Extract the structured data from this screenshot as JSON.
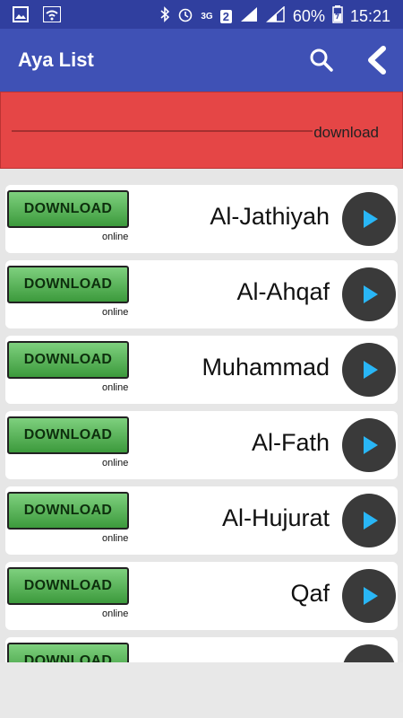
{
  "status_bar": {
    "network_type": "3G",
    "sim_slot": "2",
    "battery": "60%",
    "time": "15:21"
  },
  "app_bar": {
    "title": "Aya List"
  },
  "download_banner": {
    "label": "download",
    "color": "#e54646"
  },
  "list": {
    "items": [
      {
        "name": "Al-Jathiyah",
        "download_label": "DOWNLOAD",
        "source": "online"
      },
      {
        "name": "Al-Ahqaf",
        "download_label": "DOWNLOAD",
        "source": "online"
      },
      {
        "name": "Muhammad",
        "download_label": "DOWNLOAD",
        "source": "online"
      },
      {
        "name": "Al-Fath",
        "download_label": "DOWNLOAD",
        "source": "online"
      },
      {
        "name": "Al-Hujurat",
        "download_label": "DOWNLOAD",
        "source": "online"
      },
      {
        "name": "Qaf",
        "download_label": "DOWNLOAD",
        "source": "online"
      },
      {
        "name": "",
        "download_label": "DOWNLOAD",
        "source": ""
      }
    ]
  },
  "colors": {
    "primary": "#3f51b5",
    "primary_dark": "#303f9f",
    "download_button": "#4caf50",
    "play_button": "#3a3a3a",
    "play_icon": "#29b6f6"
  },
  "icons": [
    "image-icon",
    "wifi-icon",
    "bluetooth-icon",
    "alarm-icon",
    "signal-icon",
    "battery-icon",
    "search-icon",
    "back-chevron-icon",
    "play-icon"
  ]
}
